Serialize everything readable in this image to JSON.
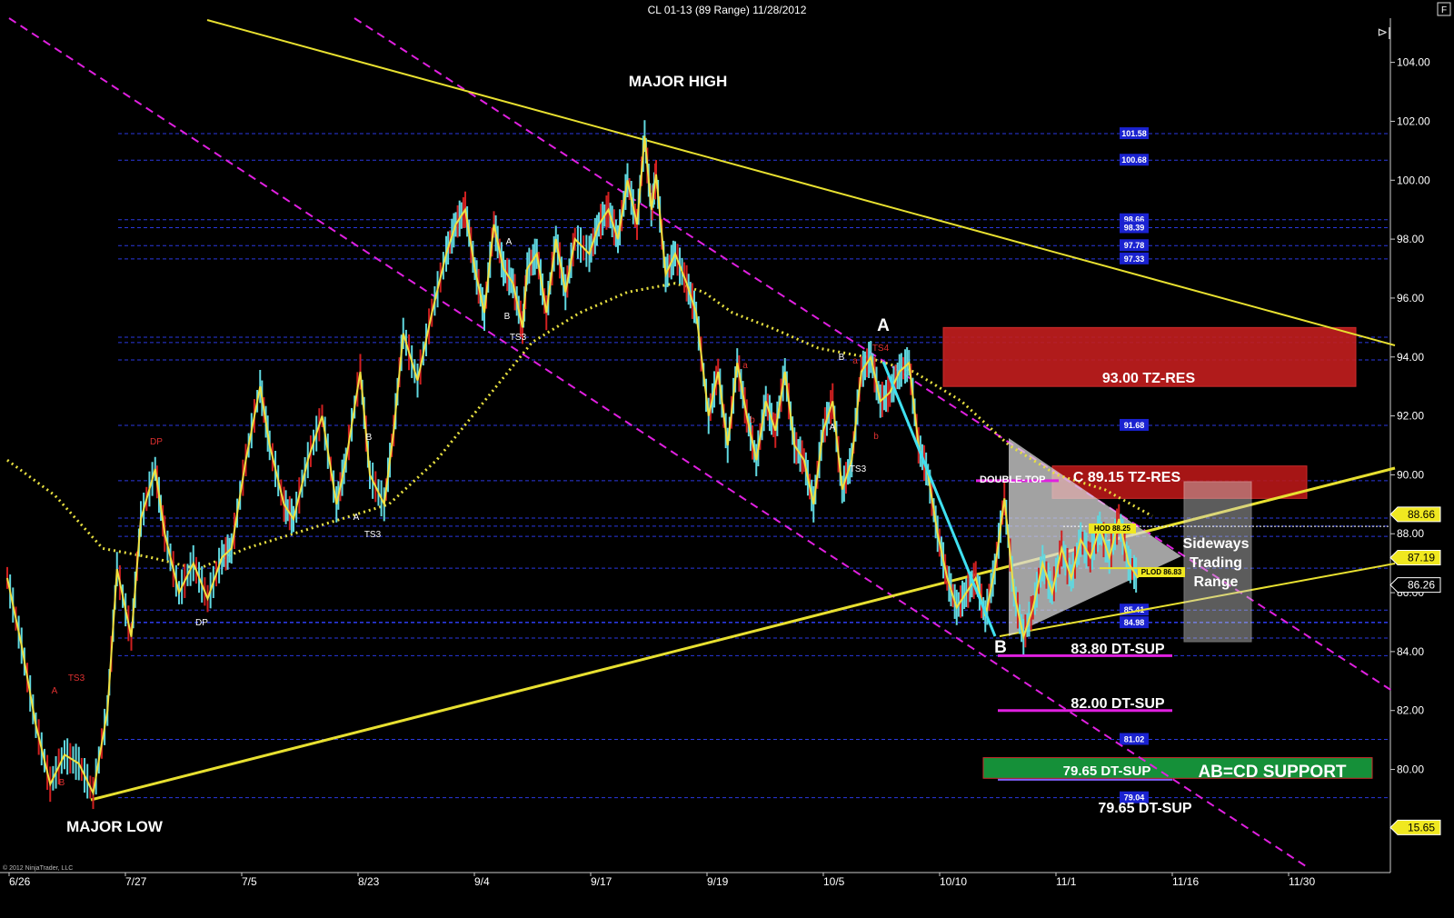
{
  "title": "CL 01-13 (89 Range)  11/28/2012",
  "window_buttons": {
    "panel": "F",
    "scroll": "⊳|"
  },
  "copyright": "© 2012 NinjaTrader, LLC",
  "chart_data": {
    "type": "line",
    "instrument": "CL 01-13 (89 Range)",
    "date": "11/28/2012",
    "y_axis": {
      "ticks": [
        104.0,
        102.0,
        100.0,
        98.0,
        96.0,
        94.0,
        92.0,
        90.0,
        88.0,
        86.0,
        84.0,
        82.0,
        80.0,
        78.0
      ],
      "min": 76.5,
      "max": 105.5
    },
    "x_axis": {
      "tick_labels": [
        "6/26",
        "7/27",
        "7/5",
        "8/23",
        "9/4",
        "9/17",
        "9/19",
        "10/5",
        "10/10",
        "11/1",
        "11/16",
        "11/30"
      ]
    },
    "price_series": {
      "name": "CL",
      "x": [
        0,
        15,
        30,
        45,
        60,
        75,
        90,
        105,
        115,
        130,
        140,
        155,
        165,
        180,
        195,
        210,
        225,
        235,
        250,
        265,
        275,
        290,
        300,
        315,
        330,
        345,
        355,
        370,
        380,
        395,
        405,
        415,
        430,
        445,
        460,
        470,
        480,
        490,
        500,
        510,
        520,
        530,
        540,
        545,
        555,
        565,
        575,
        585,
        595,
        610,
        620,
        630,
        640,
        650,
        660,
        668,
        675,
        680,
        690,
        700,
        712,
        722,
        735,
        745,
        755,
        765,
        775,
        785,
        795,
        805,
        815,
        825,
        835,
        845,
        855,
        865,
        875,
        885,
        895,
        905,
        915,
        925,
        935,
        945,
        955,
        965,
        975,
        985,
        995,
        1005,
        1015,
        1025,
        1035,
        1045,
        1055,
        1065,
        1075,
        1085,
        1095,
        1105,
        1115,
        1125,
        1135,
        1145,
        1155,
        1165,
        1175,
        1185,
        1195
      ],
      "y": [
        86.5,
        84.2,
        81.5,
        79.5,
        80.5,
        80.2,
        79.2,
        82.0,
        86.8,
        84.5,
        88.5,
        90.2,
        88.0,
        86.0,
        87.0,
        85.8,
        87.2,
        87.5,
        90.5,
        93.0,
        91.0,
        89.0,
        88.5,
        90.5,
        92.0,
        89.0,
        90.5,
        93.5,
        90.0,
        89.0,
        91.5,
        94.8,
        93.2,
        95.5,
        97.5,
        98.5,
        99.0,
        97.0,
        95.5,
        98.5,
        97.0,
        96.5,
        95.0,
        97.0,
        97.5,
        95.5,
        98.0,
        96.2,
        98.0,
        97.5,
        98.5,
        99.0,
        98.0,
        100.0,
        98.5,
        101.5,
        99.0,
        100.2,
        96.8,
        97.5,
        96.5,
        95.5,
        92.0,
        93.5,
        91.0,
        93.8,
        92.0,
        90.5,
        92.5,
        91.5,
        93.5,
        91.0,
        90.5,
        89.0,
        91.5,
        92.5,
        89.5,
        90.5,
        93.5,
        94.0,
        92.5,
        92.8,
        93.5,
        93.8,
        91.0,
        90.0,
        88.0,
        86.5,
        85.5,
        86.0,
        86.5,
        85.2,
        86.8,
        89.2,
        86.0,
        84.5,
        85.5,
        87.0,
        86.0,
        87.5,
        86.5,
        87.8,
        87.2,
        88.2,
        87.2,
        88.5,
        87.0,
        86.5
      ]
    },
    "moving_average": {
      "style": "dotted",
      "x": [
        0,
        50,
        100,
        150,
        200,
        250,
        300,
        350,
        400,
        450,
        500,
        550,
        600,
        650,
        700,
        730,
        760,
        800,
        850,
        900,
        950,
        1000,
        1050,
        1100,
        1150,
        1200
      ],
      "y": [
        90.5,
        89.3,
        87.5,
        87.2,
        86.8,
        87.5,
        88.0,
        88.5,
        89.0,
        90.5,
        92.5,
        94.5,
        95.5,
        96.2,
        96.5,
        96.2,
        95.5,
        95.0,
        94.3,
        94.0,
        93.5,
        92.5,
        91.0,
        90.0,
        89.5,
        88.6
      ]
    },
    "horizontal_levels": [
      101.58,
      100.68,
      98.66,
      98.39,
      97.78,
      97.33,
      94.67,
      94.49,
      93.9,
      91.68,
      89.8,
      88.53,
      88.26,
      87.91,
      86.83,
      85.41,
      85.0,
      84.98,
      84.46,
      83.86,
      81.02,
      79.04
    ],
    "price_tags": [
      {
        "label": "88.66",
        "value": 88.66,
        "style": "yellow"
      },
      {
        "label": "87.19",
        "value": 87.19,
        "style": "yellow"
      },
      {
        "label": "86.26",
        "value": 86.26,
        "style": "black"
      },
      {
        "label": "15.65",
        "value": 78.03,
        "style": "yellow"
      }
    ],
    "zones": [
      {
        "label": "93.00 TZ-RES",
        "value_top": 95.0,
        "value_bottom": 93.0,
        "color": "#c41e1e"
      },
      {
        "label": "C   89.15 TZ-RES",
        "value_top": 90.3,
        "value_bottom": 89.2,
        "color": "#b81818"
      },
      {
        "label": "AB=CD SUPPORT",
        "value_top": 80.4,
        "value_bottom": 79.7,
        "color": "#18a040"
      }
    ],
    "annotations": [
      {
        "text": "MAJOR HIGH",
        "kind": "label"
      },
      {
        "text": "MAJOR LOW",
        "kind": "label"
      },
      {
        "text": "A",
        "kind": "pivot"
      },
      {
        "text": "B",
        "kind": "pivot"
      },
      {
        "text": "DOUBLE-TOP",
        "kind": "label"
      },
      {
        "text": "83.80 DT-SUP",
        "kind": "level"
      },
      {
        "text": "82.00 DT-SUP",
        "kind": "level"
      },
      {
        "text": "79.65 DT-SUP",
        "kind": "level"
      },
      {
        "text": "79.65 DT-SUP",
        "kind": "level"
      },
      {
        "text": "Sideways",
        "kind": "label"
      },
      {
        "text": "Trading",
        "kind": "label"
      },
      {
        "text": "Range",
        "kind": "label"
      },
      {
        "text": "HOD 88.25",
        "kind": "tag"
      },
      {
        "text": "PLOD 86.83",
        "kind": "tag"
      }
    ],
    "small_marks": [
      "DP",
      "DP",
      "TS3",
      "TS3",
      "TS3",
      "TS3",
      "TS4",
      "A",
      "B",
      "A",
      "B",
      "A",
      "B",
      "A",
      "B",
      "a",
      "b",
      "a",
      "b"
    ],
    "grid": false,
    "legend": "none"
  }
}
